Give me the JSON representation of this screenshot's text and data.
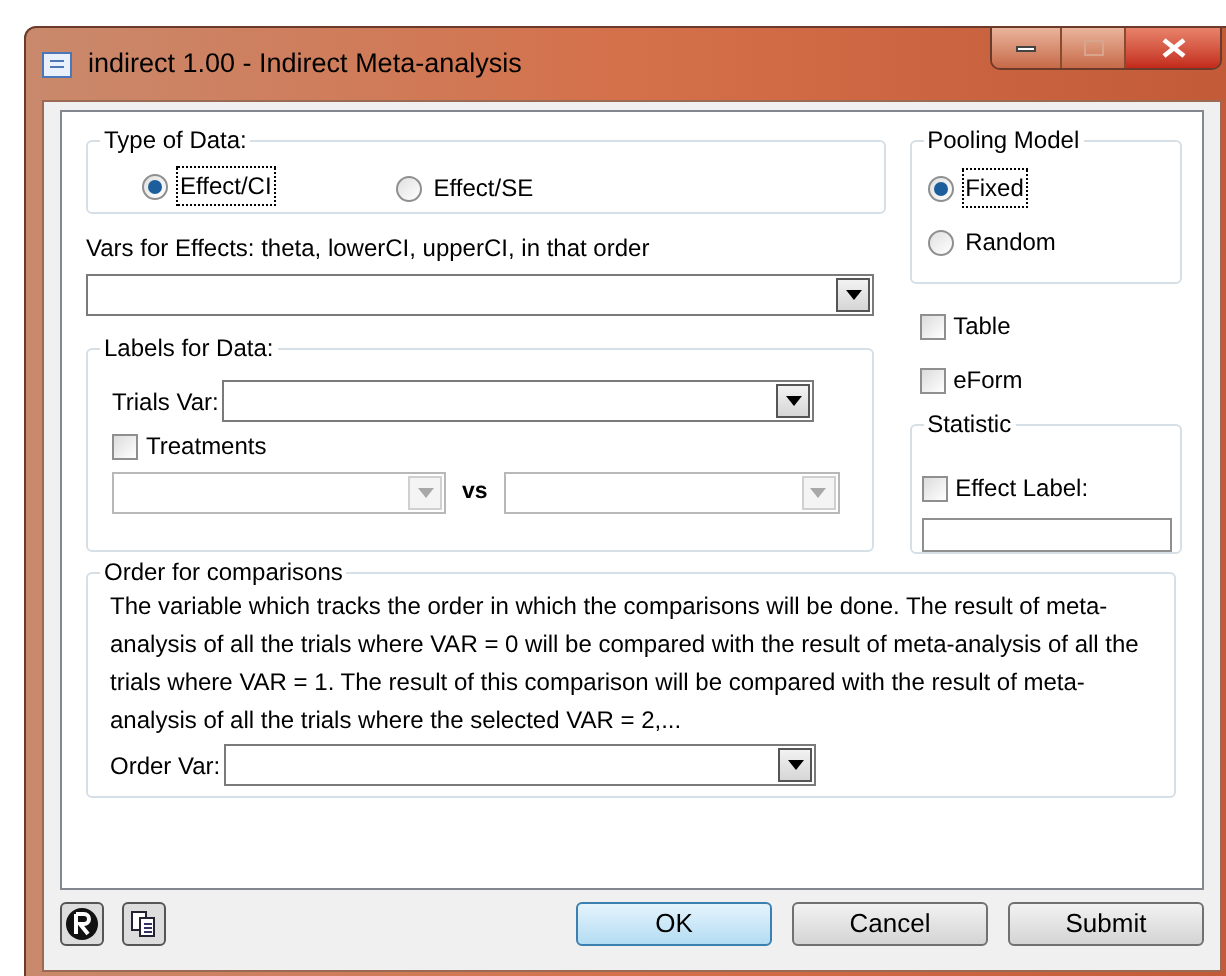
{
  "window": {
    "title": "indirect 1.00 - Indirect Meta-analysis"
  },
  "type_of_data": {
    "label": "Type of Data:",
    "options": [
      {
        "label": "Effect/CI",
        "selected": true
      },
      {
        "label": "Effect/SE",
        "selected": false
      }
    ]
  },
  "pooling_model": {
    "label": "Pooling Model",
    "options": [
      {
        "label": "Fixed",
        "selected": true
      },
      {
        "label": "Random",
        "selected": false
      }
    ]
  },
  "vars_for_effects": {
    "label": "Vars for Effects: theta, lowerCI, upperCI, in that order"
  },
  "options": [
    {
      "label": "Table",
      "checked": false
    },
    {
      "label": "eForm",
      "checked": false
    }
  ],
  "labels_for_data": {
    "label": "Labels for Data:",
    "trials_var_label": "Trials Var:",
    "treatments": {
      "label": "Treatments",
      "checked": false
    },
    "vs": "vs"
  },
  "statistic": {
    "label": "Statistic",
    "effect_label": {
      "label": "Effect Label:",
      "checked": false
    }
  },
  "order": {
    "label": "Order for comparisons",
    "description": "The variable which tracks the order in which the comparisons will be done. The result of meta-analysis of all the trials where VAR = 0 will be compared with the result of meta-analysis of all the trials where VAR = 1. The result of this comparison will be compared with the result of meta-analysis of all the trials where the selected VAR = 2,...",
    "order_var_label": "Order Var:"
  },
  "buttons": [
    {
      "label": "OK",
      "kind": "default"
    },
    {
      "label": "Cancel",
      "kind": "normal"
    },
    {
      "label": "Submit",
      "kind": "normal"
    }
  ]
}
